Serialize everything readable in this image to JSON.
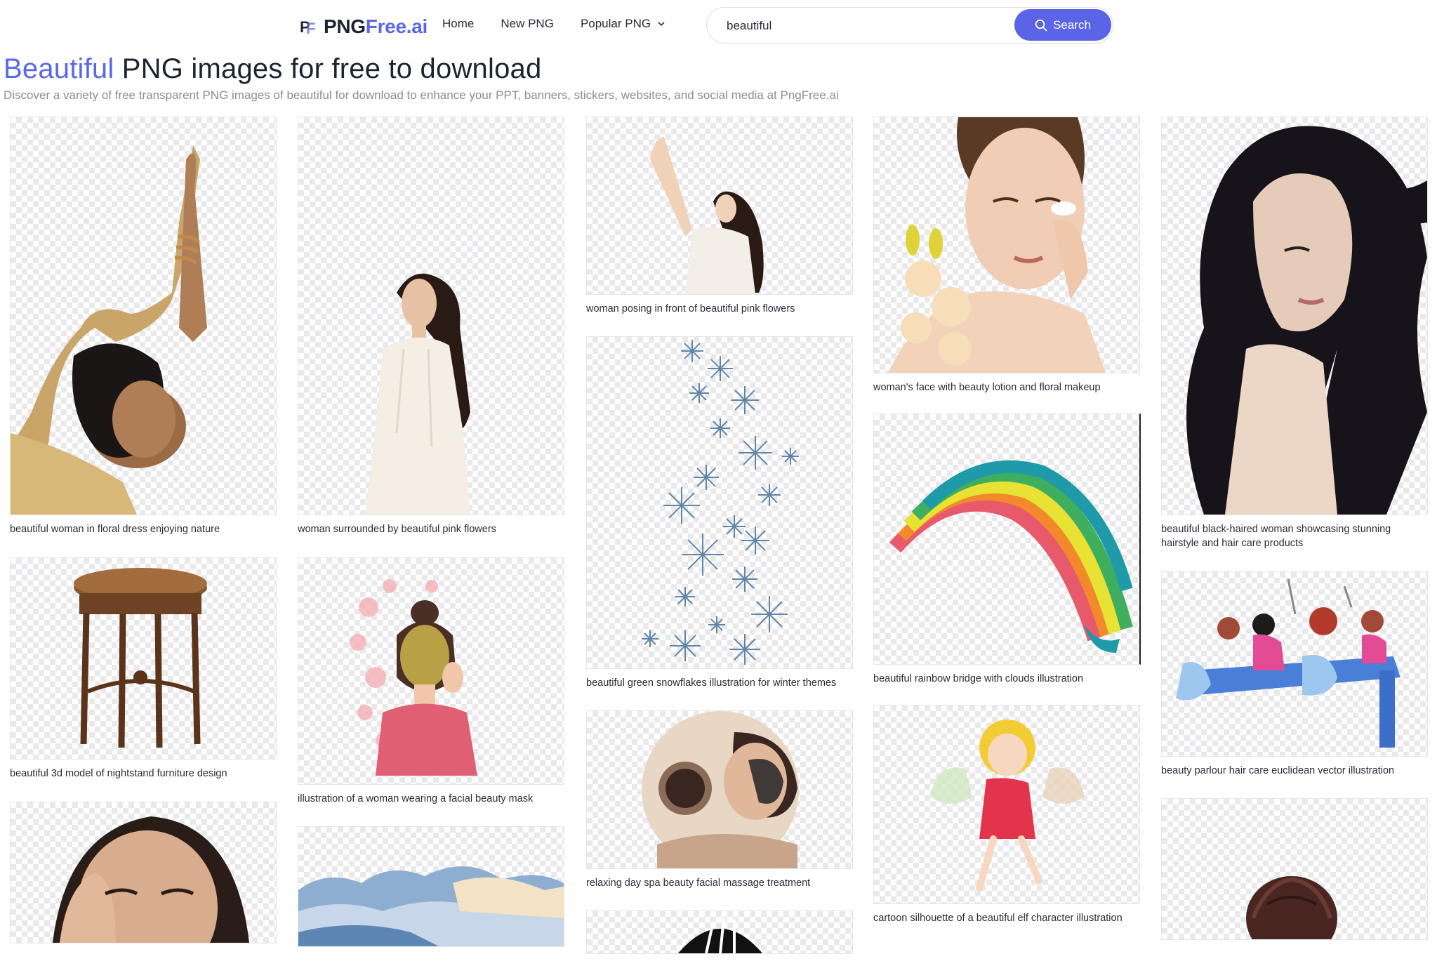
{
  "header": {
    "logo_a": "PNG",
    "logo_b": "Free.ai",
    "logo_mark_p": "P",
    "logo_mark_f": "F",
    "nav": {
      "home": "Home",
      "new_png": "New PNG",
      "popular_png": "Popular PNG"
    },
    "search": {
      "value": "beautiful",
      "button_label": "Search"
    }
  },
  "title": {
    "keyword": "Beautiful",
    "rest": "PNG images for free to download"
  },
  "subtitle": "Discover a variety of free transparent PNG images of beautiful for download to enhance your PPT, banners, stickers, websites, and social media at PngFree.ai",
  "results": [
    {
      "caption": "beautiful woman in floral dress enjoying nature",
      "icon": "woman-arms-raised-image"
    },
    {
      "caption": "beautiful 3d model of nightstand furniture design",
      "icon": "nightstand-image"
    },
    {
      "caption": "",
      "icon": "woman-face-hand-image"
    },
    {
      "caption": "woman surrounded by beautiful pink flowers",
      "icon": "woman-white-dress-image"
    },
    {
      "caption": "illustration of a woman wearing a facial beauty mask",
      "icon": "facial-mask-illustration-image"
    },
    {
      "caption": "",
      "icon": "clouds-image"
    },
    {
      "caption": "woman posing in front of beautiful pink flowers",
      "icon": "woman-posing-image"
    },
    {
      "caption": "beautiful green snowflakes illustration for winter themes",
      "icon": "snowflakes-image"
    },
    {
      "caption": "relaxing day spa beauty facial massage treatment",
      "icon": "spa-facial-image"
    },
    {
      "caption": "",
      "icon": "striped-object-image"
    },
    {
      "caption": "woman's face with beauty lotion and floral makeup",
      "icon": "woman-lotion-face-image"
    },
    {
      "caption": "beautiful rainbow bridge with clouds illustration",
      "icon": "rainbow-image"
    },
    {
      "caption": "cartoon silhouette of a beautiful elf character illustration",
      "icon": "elf-cartoon-image"
    },
    {
      "caption": "beautiful black-haired woman showcasing stunning hairstyle and hair care products",
      "icon": "black-hair-woman-image"
    },
    {
      "caption": "beauty parlour hair care euclidean vector illustration",
      "icon": "beauty-parlour-image"
    },
    {
      "caption": "",
      "icon": "hair-bun-image"
    }
  ]
}
